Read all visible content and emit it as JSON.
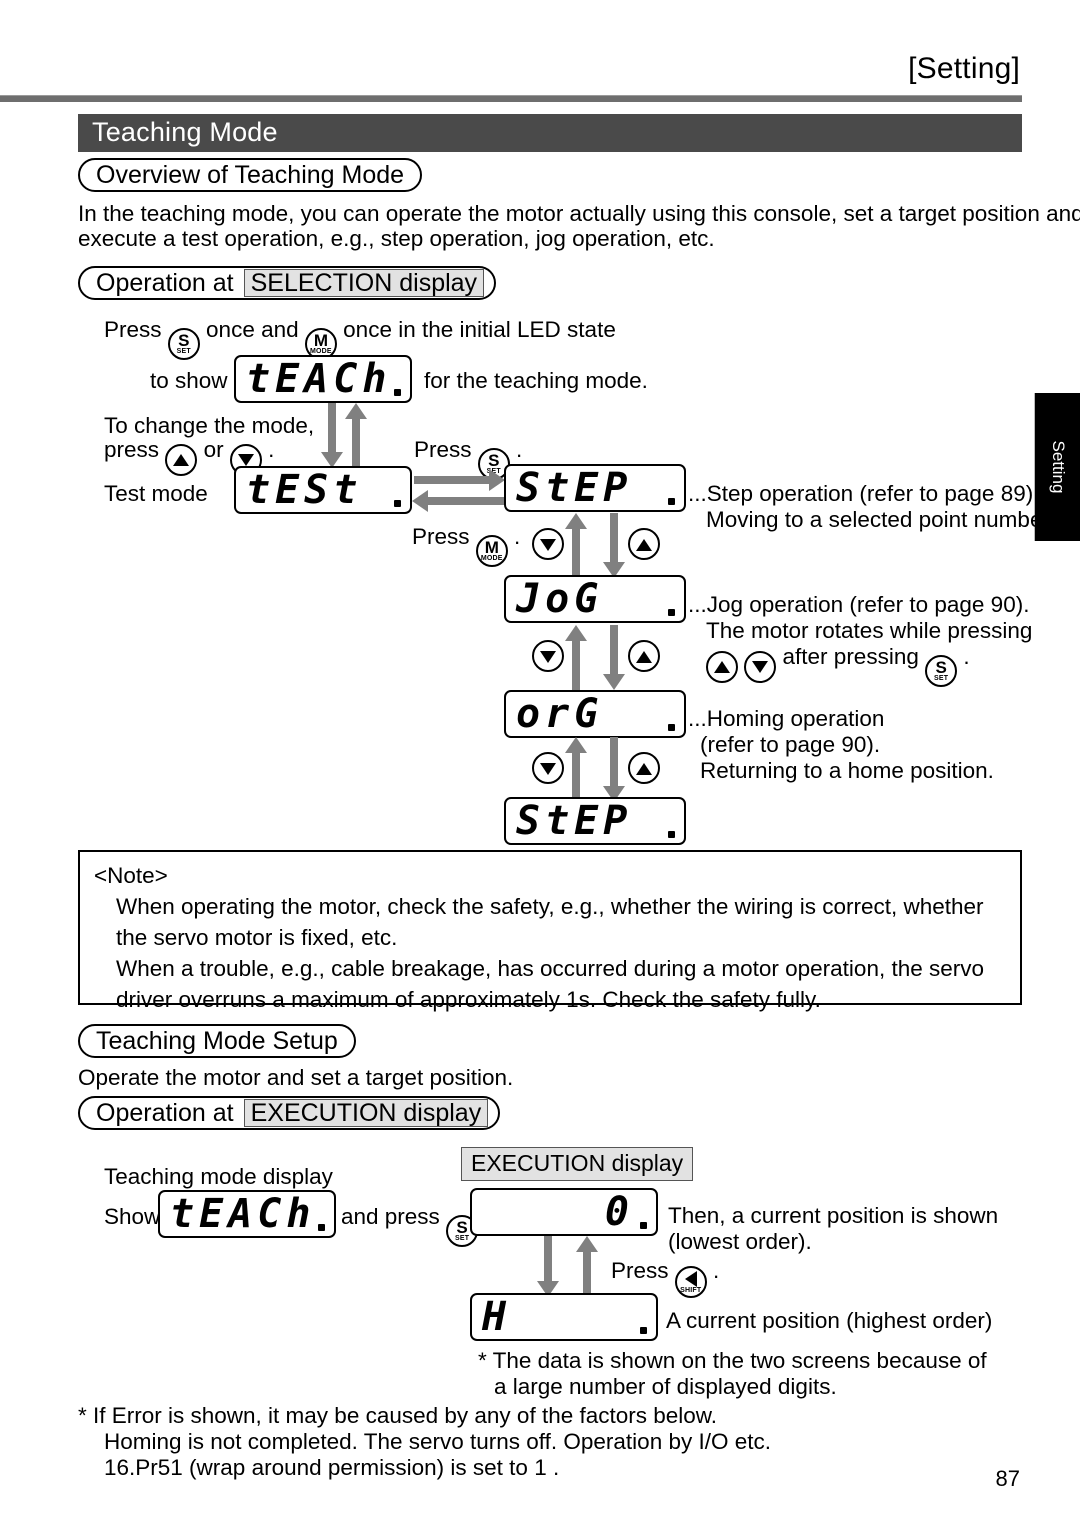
{
  "header": {
    "running_head": "[Setting]",
    "chapter_title": "Teaching Mode",
    "side_tab": "Setting"
  },
  "overview": {
    "heading": "Overview of Teaching Mode",
    "paragraph_line1": "In the teaching mode, you can operate the motor actually using this console, set a target position and",
    "paragraph_line2": "execute a test operation, e.g., step operation, jog operation, etc."
  },
  "selection": {
    "heading_prefix": "Operation at",
    "heading_highlight": "SELECTION display",
    "press_prefix": "Press",
    "press_mid": "once and",
    "press_suffix": "once in the initial LED state",
    "to_show": "to show",
    "for_teaching": "for the teaching mode.",
    "change_mode_line1": "To change the mode,",
    "change_mode_line2_prefix": "press",
    "change_mode_or": "or",
    "change_mode_period": ".",
    "test_mode_label": "Test mode",
    "press_s_label": "Press",
    "press_s_period": ".",
    "press_m_label": "Press",
    "press_m_period": ".",
    "displays": {
      "teach": "tEACh",
      "test": "tESt",
      "step": "StEP",
      "jog": "JoG",
      "org": "orG",
      "step2": "StEP"
    },
    "annotations": {
      "step_line1": "...Step operation   (refer to page 89).",
      "step_line2": "Moving to a selected point number.",
      "jog_line1": "...Jog operation   (refer to page 90).",
      "jog_line2": "The motor rotates while pressing",
      "jog_line3_mid": "after pressing",
      "jog_line3_end": ".",
      "org_line1": "...Homing operation",
      "org_line2": "(refer to page 90).",
      "org_line3": "Returning to a home position."
    }
  },
  "note": {
    "title": "<Note>",
    "line1": "When operating the motor, check the safety, e.g., whether the wiring is correct, whether",
    "line2": "the servo motor is fixed, etc.",
    "line3": "When a trouble, e.g., cable breakage, has occurred during a motor operation, the servo",
    "line4": "driver overruns a maximum of approximately 1s. Check the safety fully."
  },
  "setup": {
    "heading": "Teaching Mode Setup",
    "paragraph": "Operate the motor and set a target position.",
    "exec_heading_prefix": "Operation at",
    "exec_heading_highlight": "EXECUTION display",
    "exec_display_label": "EXECUTION display",
    "teaching_mode_display_label": "Teaching mode display",
    "show_label": "Show",
    "and_press_label": "and press",
    "and_press_period": ".",
    "displays": {
      "teach": "tEACh",
      "value_zero": "0",
      "highest": "H"
    },
    "then_current_line1": "Then, a current position is shown",
    "then_current_line2": "(lowest order).",
    "press_shift_label": "Press",
    "press_shift_period": ".",
    "highest_order_label": "A current position (highest order)",
    "two_screens_line1": "* The data is shown on the two screens because of",
    "two_screens_line2": "a large number of displayed digits."
  },
  "footnotes": {
    "line1": "* If  Error  is shown, it may be caused by any of the factors below.",
    "line2": "Homing is not completed.     The servo turns off.     Operation by I/O etc.",
    "line3": "16.Pr51 (wrap around permission) is set to  1 ."
  },
  "keys": {
    "set": {
      "main": "S",
      "sub": "SET"
    },
    "mode": {
      "main": "M",
      "sub": "MODE"
    },
    "up": {
      "icon": "triangle-up"
    },
    "down": {
      "icon": "triangle-down"
    },
    "shift": {
      "icon": "triangle-left",
      "sub": "SHIFT"
    }
  },
  "page_number": "87",
  "colors": {
    "bar": "#4a4a4a",
    "rule": "#6e6e6e",
    "arrow": "#808080",
    "highlight": "#e2e2e2",
    "tab": "#000000"
  }
}
